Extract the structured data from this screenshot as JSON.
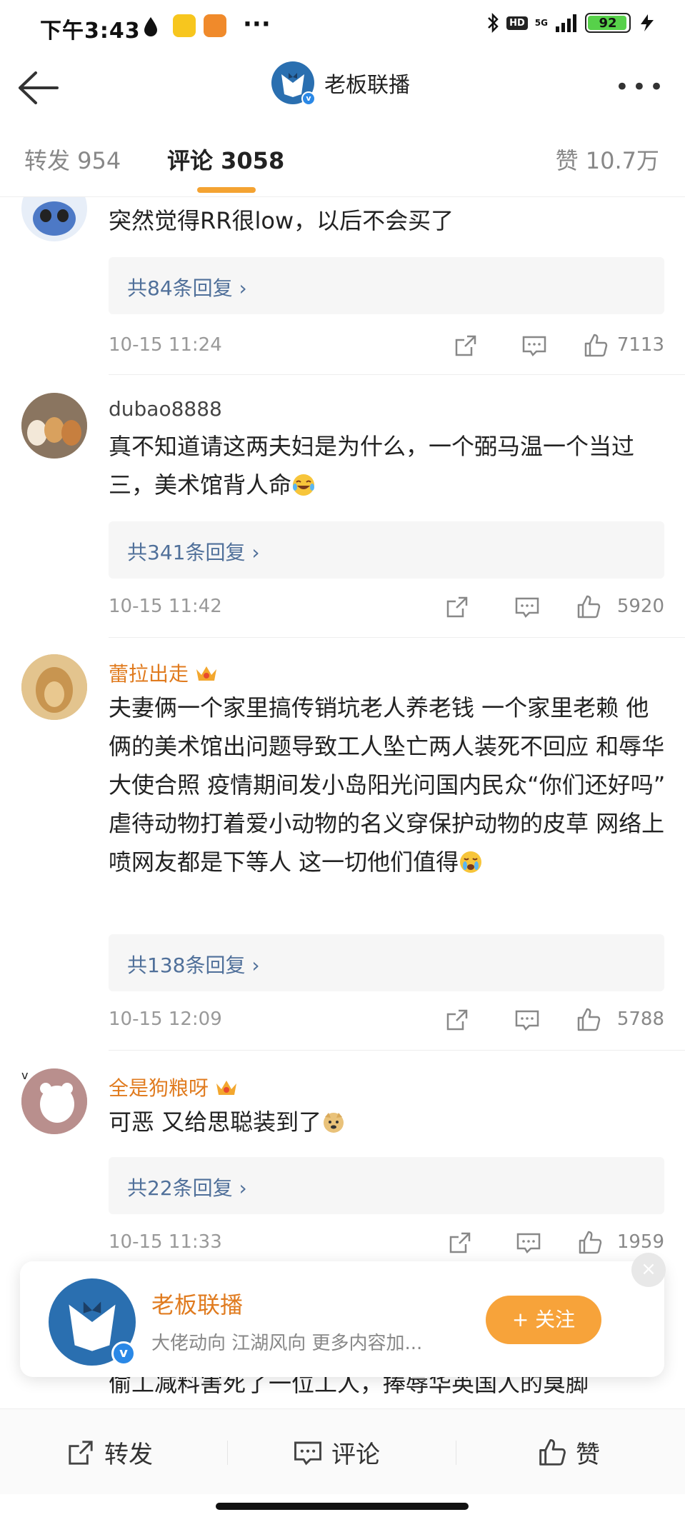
{
  "status_bar": {
    "time": "下午3:43",
    "hd": "HD",
    "network": "5G",
    "battery": "92"
  },
  "header": {
    "title": "老板联播",
    "verified_mark": "v"
  },
  "tabs": {
    "repost": "转发 954",
    "comment": "评论 3058",
    "likes": "赞 10.7万"
  },
  "comments": [
    {
      "username": "",
      "text": "突然觉得RR很low，以后不会买了",
      "replies": "共84条回复 ›",
      "time": "10-15 11:24",
      "likes": "7113",
      "verified": "v"
    },
    {
      "username": "dubao8888",
      "text": "真不知道请这两夫妇是为什么，一个弼马温一个当过三，美术馆背人命",
      "replies": "共341条回复 ›",
      "time": "10-15 11:42",
      "likes": "5920"
    },
    {
      "username": "蕾拉出走",
      "text": "夫妻俩一个家里搞传销坑老人养老钱 一个家里老赖  他俩的美术馆出问题导致工人坠亡两人装死不回应 和辱华大使合照 疫情期间发小岛阳光问国内民众“你们还好吗” 虐待动物打着爱小动物的名义穿保护动物的皮草 网络上喷网友都是下等人 这一切他们值得",
      "replies": "共138条回复 ›",
      "time": "10-15 12:09",
      "likes": "5788"
    },
    {
      "username": "全是狗粮呀",
      "text": "可恶 又给思聪装到了",
      "replies": "共22条回复 ›",
      "time": "10-15 11:33",
      "likes": "1959",
      "verified": "v"
    }
  ],
  "popup": {
    "name": "老板联播",
    "description": "大佬动向 江湖风向 更多内容加...",
    "follow_label": "+ 关注",
    "close": "×"
  },
  "peek_text": "偷工减料害死了一位工人，捧辱华英国人的臭脚",
  "bottom_bar": {
    "repost": "转发",
    "comment": "评论",
    "like": "赞"
  },
  "colors": {
    "accent": "#f4a332",
    "vip_name": "#e07b1f",
    "link": "#50709a",
    "follow_button": "#f7a33a"
  }
}
